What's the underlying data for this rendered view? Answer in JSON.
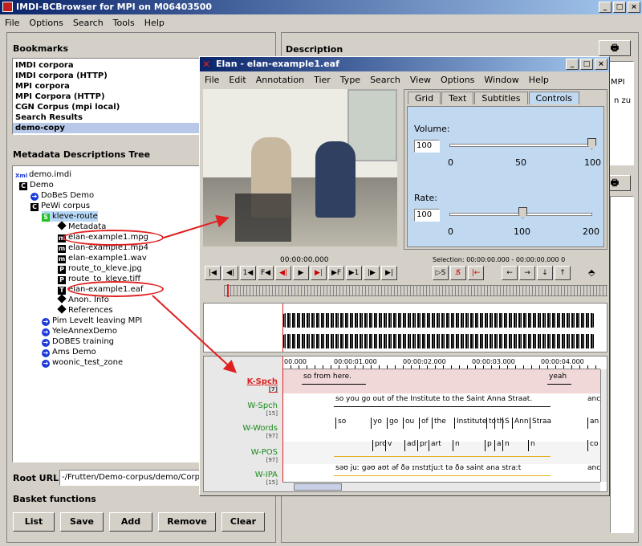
{
  "main": {
    "title": "IMDI-BCBrowser for MPI on M06403500",
    "menu": [
      "File",
      "Options",
      "Search",
      "Tools",
      "Help"
    ]
  },
  "bookmarks": {
    "title": "Bookmarks",
    "items": [
      "IMDI corpora",
      "IMDI corpora (HTTP)",
      "MPI corpora",
      "MPI Corpora (HTTP)",
      "CGN Corpus (mpi local)",
      "Search Results",
      "demo-copy"
    ]
  },
  "tree": {
    "title": "Metadata Descriptions Tree",
    "root": "demo.imdi",
    "demo": "Demo",
    "dobes": "DoBeS Demo",
    "pewi": "PeWi corpus",
    "kleve": "kleve-route",
    "metadata": "Metadata",
    "mpg": "elan-example1.mpg",
    "mp4": "elan-example1.mp4",
    "wav": "elan-example1.wav",
    "jpg": "route_to_kleve.jpg",
    "tiff": "route_to_kleve.tiff",
    "eaf": "elan-example1.eaf",
    "anon": "Anon. Info",
    "refs": "References",
    "pim": "Pim Levelt leaving MPI",
    "yele": "YeleAnnexDemo",
    "dobestr": "DOBES training",
    "ams": "Ams Demo",
    "woonic": "woonic_test_zone"
  },
  "root_url": {
    "label": "Root URL",
    "value": "-/Frutten/Demo-corpus/demo/Corpuss"
  },
  "basket": {
    "title": "Basket functions",
    "buttons": [
      "List",
      "Save",
      "Add",
      "Remove",
      "Clear"
    ]
  },
  "description": {
    "title": "Description",
    "frag1": "MPI",
    "frag2": "n zu"
  },
  "elan": {
    "title": "Elan - elan-example1.eaf",
    "menu": [
      "File",
      "Edit",
      "Annotation",
      "Tier",
      "Type",
      "Search",
      "View",
      "Options",
      "Window",
      "Help"
    ],
    "tabs": [
      "Grid",
      "Text",
      "Subtitles",
      "Controls"
    ],
    "volume": {
      "label": "Volume:",
      "value": "100",
      "ticks": [
        "0",
        "50",
        "100"
      ],
      "level": 1.0
    },
    "rate": {
      "label": "Rate:",
      "value": "100",
      "ticks": [
        "0",
        "100",
        "200"
      ],
      "level": 0.5
    },
    "time": "00:00:00.000",
    "selection": "Selection: 00:00:00.000 - 00:00:00.000  0",
    "ruler": [
      "00.000",
      "00:00:01.000",
      "00:00:02.000",
      "00:00:03.000",
      "00:00:04.000"
    ],
    "tiers": [
      {
        "name": "K-Spch",
        "count": "[7]"
      },
      {
        "name": "W-Spch",
        "count": "[15]"
      },
      {
        "name": "W-Words",
        "count": "[97]"
      },
      {
        "name": "W-POS",
        "count": "[97]"
      },
      {
        "name": "W-IPA",
        "count": "[15]"
      }
    ],
    "kspch": [
      "so from here.",
      "yeah"
    ],
    "wspch": [
      "so you go out of the Institute to the Saint Anna Straat.",
      "anc"
    ],
    "words": [
      "so",
      "yo",
      "go",
      "ou",
      "of",
      "the",
      "Institute",
      "to",
      "th",
      "S",
      "Ann",
      "Straa",
      "an"
    ],
    "pos": [
      "pro",
      "v",
      "ad",
      "pr",
      "art",
      "n",
      "p",
      "a",
      "n",
      "n",
      "co"
    ],
    "ipa": [
      "səʊ  juː gəʊ aʊt əf ðə ɪnstɪtjuːt tə ðə saint ana straːt",
      "anc"
    ]
  }
}
